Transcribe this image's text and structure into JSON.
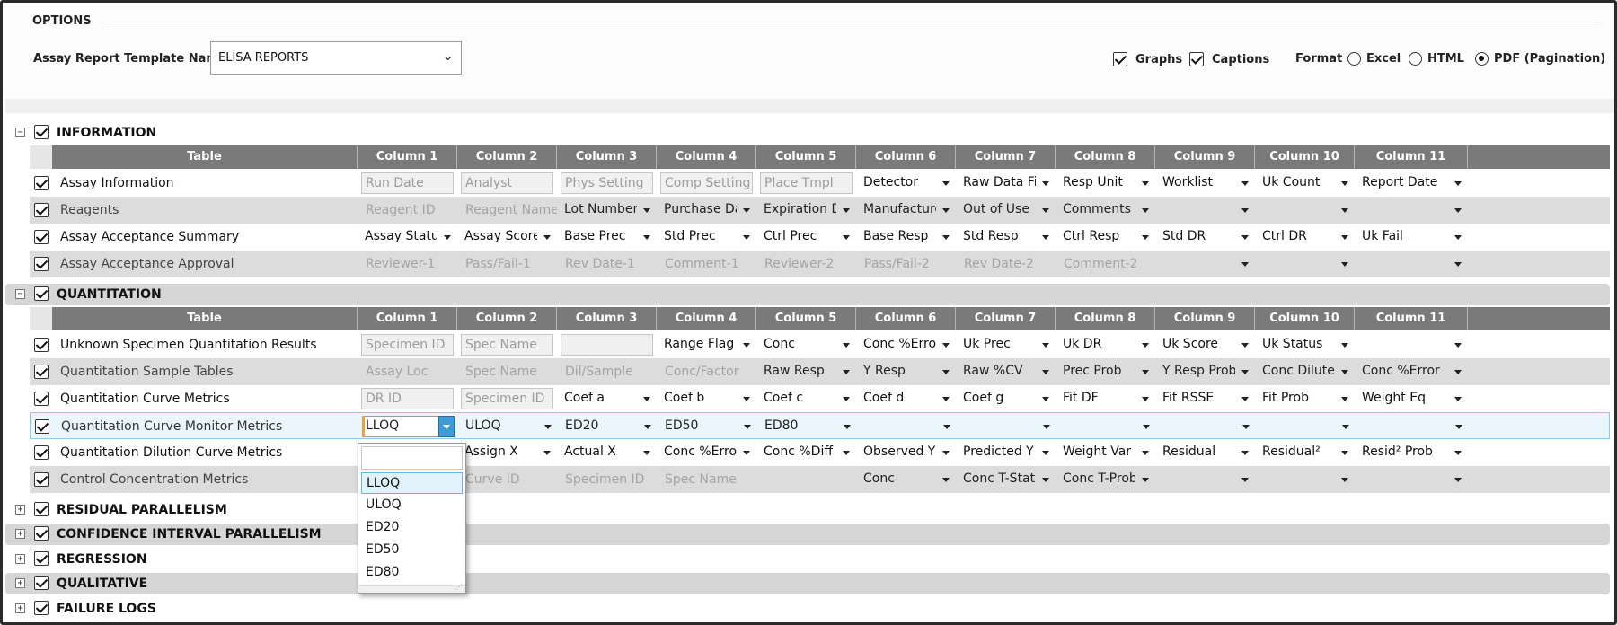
{
  "options": {
    "title": "OPTIONS",
    "template_label": "Assay Report Template Name",
    "template_value": "ELISA REPORTS",
    "graphs_label": "Graphs",
    "captions_label": "Captions",
    "format_label": "Format",
    "format_options": [
      "Excel",
      "HTML",
      "PDF (Pagination)"
    ],
    "format_selected": "PDF (Pagination)"
  },
  "columns": [
    "Table",
    "Column 1",
    "Column 2",
    "Column 3",
    "Column 4",
    "Column 5",
    "Column 6",
    "Column 7",
    "Column 8",
    "Column 9",
    "Column 10",
    "Column 11"
  ],
  "sections": {
    "information": "INFORMATION",
    "quantitation": "QUANTITATION",
    "residual": "RESIDUAL PARALLELISM",
    "confidence": "CONFIDENCE INTERVAL PARALLELISM",
    "regression": "REGRESSION",
    "qualitative": "QUALITATIVE",
    "failure": "FAILURE LOGS"
  },
  "info_rows": [
    {
      "name": "Assay Information",
      "cells": [
        "Run Date",
        "Analyst",
        "Phys Setting",
        "Comp Setting",
        "Place Tmpl",
        "Detector",
        "Raw Data File",
        "Resp Unit",
        "Worklist",
        "Uk Count",
        "Report Date"
      ]
    },
    {
      "name": "Reagents",
      "cells": [
        "Reagent ID",
        "Reagent Name",
        "Lot Number",
        "Purchase Date",
        "Expiration Date",
        "Manufacturer",
        "Out of Use",
        "Comments",
        "",
        "",
        ""
      ]
    },
    {
      "name": "Assay Acceptance Summary",
      "cells": [
        "Assay Status",
        "Assay Score",
        "Base Prec",
        "Std Prec",
        "Ctrl Prec",
        "Base Resp",
        "Std Resp",
        "Ctrl Resp",
        "Std DR",
        "Ctrl DR",
        "Uk Fail"
      ]
    },
    {
      "name": "Assay Acceptance Approval",
      "cells": [
        "Reviewer-1",
        "Pass/Fail-1",
        "Rev Date-1",
        "Comment-1",
        "Reviewer-2",
        "Pass/Fail-2",
        "Rev Date-2",
        "Comment-2",
        "",
        "",
        ""
      ]
    }
  ],
  "quant_rows": [
    {
      "name": "Unknown Specimen Quantitation Results",
      "cells": [
        "Specimen ID",
        "Spec Name",
        "",
        "Range Flag",
        "Conc",
        "Conc %Error",
        "Uk Prec",
        "Uk DR",
        "Uk Score",
        "Uk Status",
        ""
      ]
    },
    {
      "name": "Quantitation Sample Tables",
      "cells": [
        "Assay Loc",
        "Spec Name",
        "Dil/Sample",
        "Conc/Factor",
        "Raw Resp",
        "Y Resp",
        "Raw %CV",
        "Prec Prob",
        "Y Resp Prob",
        "Conc Diluted",
        "Conc %Error"
      ]
    },
    {
      "name": "Quantitation Curve Metrics",
      "cells": [
        "DR ID",
        "Specimen ID",
        "Coef a",
        "Coef b",
        "Coef c",
        "Coef d",
        "Coef g",
        "Fit DF",
        "Fit RSSE",
        "Fit Prob",
        "Weight Eq"
      ]
    },
    {
      "name": "Quantitation Curve Monitor Metrics",
      "cells": [
        "LLOQ",
        "ULOQ",
        "ED20",
        "ED50",
        "ED80",
        "",
        "",
        "",
        "",
        "",
        ""
      ]
    },
    {
      "name": "Quantitation Dilution Curve Metrics",
      "cells": [
        "",
        "Assign X",
        "Actual X",
        "Conc %Error",
        "Conc %Diff",
        "Observed Y",
        "Predicted Y",
        "Weight Var",
        "Residual",
        "Residual²",
        "Resid² Prob"
      ]
    },
    {
      "name": "Control Concentration Metrics",
      "cells": [
        "",
        "Curve ID",
        "Specimen ID",
        "Spec Name",
        "",
        "Conc",
        "Conc T-Stat",
        "Conc T-Prob",
        "",
        "",
        ""
      ]
    }
  ],
  "dropdown_options": [
    "LLOQ",
    "ULOQ",
    "ED20",
    "ED50",
    "ED80"
  ]
}
